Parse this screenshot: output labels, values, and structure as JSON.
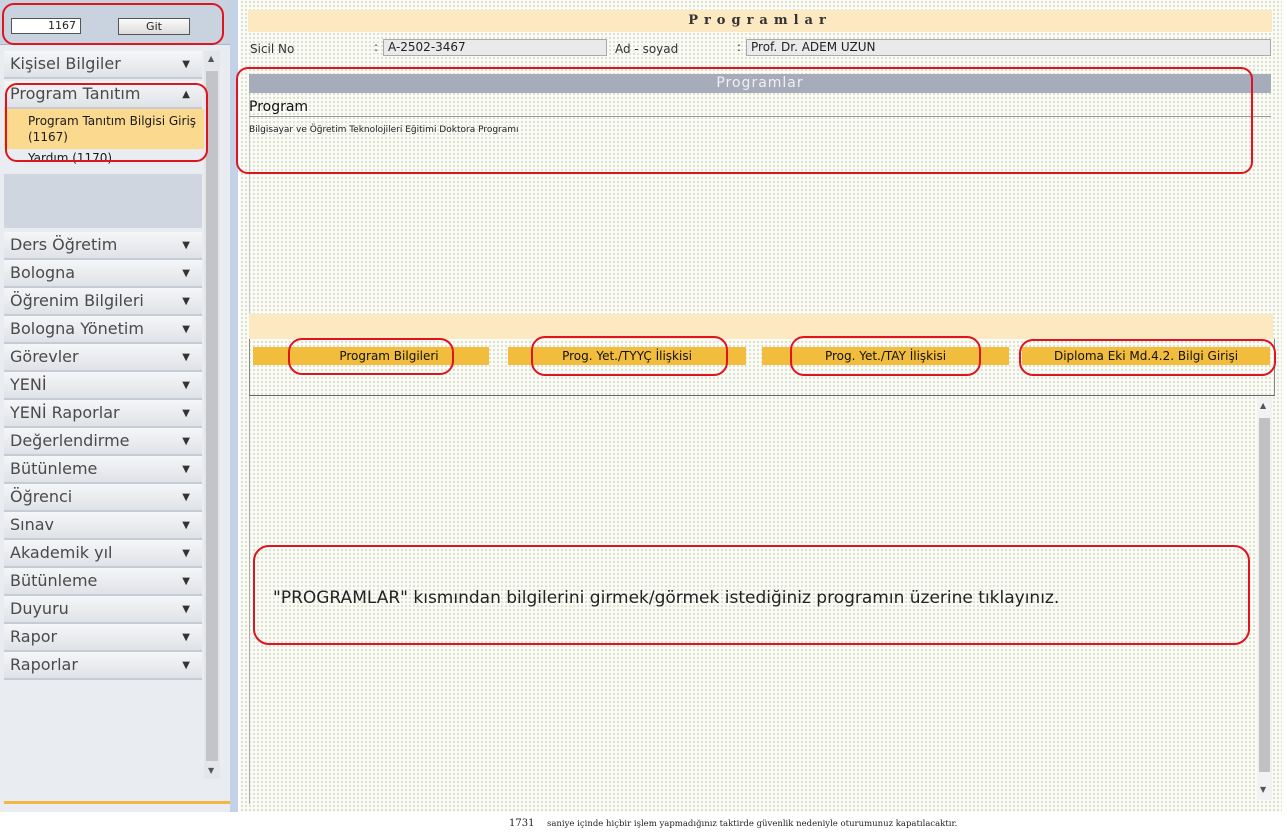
{
  "top": {
    "code_value": "1167",
    "go_label": "Git"
  },
  "menu": {
    "group1": {
      "label": "Kişisel Bilgiler"
    },
    "group2": {
      "label": "Program Tanıtım",
      "items": [
        {
          "label": "Program Tanıtım Bilgisi Giriş (1167)"
        },
        {
          "label": "Yardım (1170)"
        }
      ]
    },
    "others": [
      {
        "label": "Ders Öğretim"
      },
      {
        "label": "Bologna"
      },
      {
        "label": "Öğrenim Bilgileri"
      },
      {
        "label": "Bologna Yönetim"
      },
      {
        "label": "Görevler"
      },
      {
        "label": "YENİ"
      },
      {
        "label": "YENİ Raporlar"
      },
      {
        "label": "Değerlendirme"
      },
      {
        "label": "Bütünleme"
      },
      {
        "label": "Öğrenci"
      },
      {
        "label": "Sınav"
      },
      {
        "label": "Akademik yıl"
      },
      {
        "label": "Bütünleme"
      },
      {
        "label": "Duyuru"
      },
      {
        "label": "Rapor"
      },
      {
        "label": "Raporlar"
      }
    ]
  },
  "main": {
    "title": "Programlar",
    "sicil_label": "Sicil No",
    "sicil_sep": ":",
    "sicil_value": "A-2502-3467",
    "name_label": "Ad - soyad",
    "name_sep": ":",
    "name_value": "Prof. Dr. ADEM UZUN",
    "list_header": "Programlar",
    "column": "Program",
    "rows": [
      "Bilgisayar ve Öğretim Teknolojileri Eğitimi Doktora Programı"
    ],
    "tabs": [
      {
        "label": "Program Bilgileri"
      },
      {
        "label": "Prog. Yet./TYYÇ İlişkisi"
      },
      {
        "label": "Prog. Yet./TAY İlişkisi"
      },
      {
        "label": "Diploma Eki Md.4.2. Bilgi Girişi"
      }
    ],
    "message": "\"PROGRAMLAR\" kısmından bilgilerini girmek/görmek istediğiniz programın üzerine  tıklayınız."
  },
  "footer": {
    "seconds": "1731",
    "text": "saniye içinde hiçbir işlem yapmadığınız taktirde güvenlik nedeniyle oturumunuz kapatılacaktır."
  },
  "colors": {
    "accent": "#f2bd3c",
    "highlight": "#e0141e",
    "header_band": "#fde9c1"
  },
  "icons": [
    "chevron-down-icon",
    "chevron-up-icon",
    "scroll-up-icon",
    "scroll-down-icon"
  ]
}
